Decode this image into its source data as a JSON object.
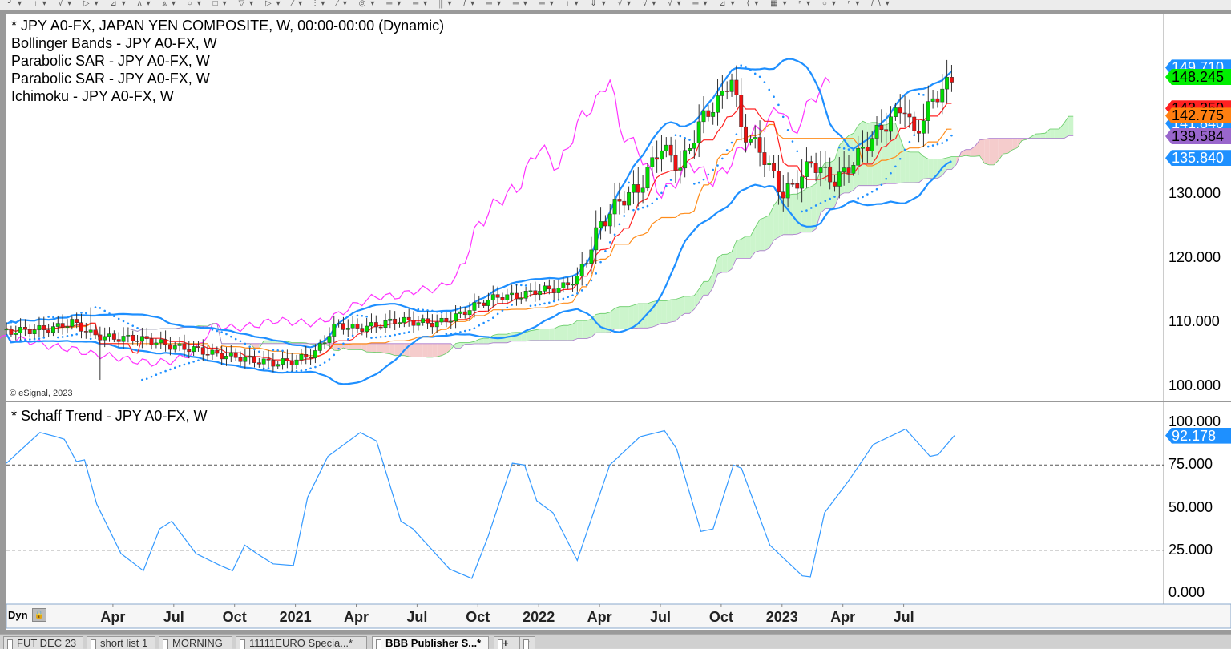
{
  "toolbar": {
    "icons": "╯▾ ↑▾ √▾ ▷▾ ⊿▾ ʌ▾ ⩓▾ ○▾ □▾ ▽▾ ▷▾ ⁄▾ ⫶▾ ⁄▾ ◎▾ ═▾ ═▾ ⫼▾ /▾ ═▾ ═▾ ═▾ ↑▾ ⇓▾ √▾ √▾ √▾ ═▾ ⊿▾ ⟨▾ ▦▾ ⁿ▾ ○▾ ⁿ▾ /\\▾"
  },
  "legend": [
    "* JPY A0-FX, JAPAN YEN COMPOSITE, W, 00:00-00:00 (Dynamic)",
    "Bollinger Bands - JPY A0-FX, W",
    "Parabolic SAR - JPY A0-FX, W",
    "Parabolic SAR - JPY A0-FX, W",
    "Ichimoku - JPY A0-FX, W"
  ],
  "copyright": "© eSignal, 2023",
  "lower_legend": "* Schaff Trend - JPY A0-FX, W",
  "badges": [
    {
      "value": "149.710",
      "color": "#1e90ff",
      "text": "#fff",
      "price": 149.71
    },
    {
      "value": "148.245",
      "color": "#00ee00",
      "text": "#000",
      "price": 148.245
    },
    {
      "value": "143.350",
      "color": "#ff2020",
      "text": "#000",
      "price": 143.35
    },
    {
      "value": "141.840",
      "color": "#1e90ff",
      "text": "#fff",
      "price": 141.0
    },
    {
      "value": "142.775",
      "color": "#ff7f11",
      "text": "#000",
      "price": 142.2
    },
    {
      "value": "139.584",
      "color": "#9966cc",
      "text": "#000",
      "price": 139.0
    },
    {
      "value": "135.840",
      "color": "#1e90ff",
      "text": "#fff",
      "price": 135.6
    }
  ],
  "schaff_badge": {
    "value": "92.178",
    "color": "#1e90ff",
    "text": "#fff"
  },
  "price_axis": [
    "100.000",
    "110.000",
    "120.000",
    "130.000"
  ],
  "schaff_axis": [
    "0.000",
    "25.000",
    "50.000",
    "75.000",
    "100.000"
  ],
  "x_labels": [
    {
      "m": 3,
      "label": "Apr"
    },
    {
      "m": 6,
      "label": "Jul"
    },
    {
      "m": 9,
      "label": "Oct"
    },
    {
      "m": 12,
      "label": "2021"
    },
    {
      "m": 15,
      "label": "Apr"
    },
    {
      "m": 18,
      "label": "Jul"
    },
    {
      "m": 21,
      "label": "Oct"
    },
    {
      "m": 24,
      "label": "2022"
    },
    {
      "m": 27,
      "label": "Apr"
    },
    {
      "m": 30,
      "label": "Jul"
    },
    {
      "m": 33,
      "label": "Oct"
    },
    {
      "m": 36,
      "label": "2023"
    },
    {
      "m": 39,
      "label": "Apr"
    },
    {
      "m": 42,
      "label": "Jul"
    }
  ],
  "dyn": "Dyn",
  "tabs": [
    "FUT DEC 23",
    "short list 1",
    "MORNING",
    "11111EURO Specia...*",
    "BBB  Publisher S...*"
  ],
  "tab_add": "+",
  "colors": {
    "up": "#00dd00",
    "down": "#ee1111",
    "bb": "#1e8fff",
    "tenkan": "#ff2020",
    "kijun": "#ff8c1a",
    "chikou": "#ff33ff",
    "sar": "#1e8fff",
    "cloud_up": "#ccf5cc",
    "cloud_down": "#f5cccc",
    "schaff": "#3399ff"
  },
  "chart_data": {
    "type": "candlestick",
    "title": "JPY A0-FX, JAPAN YEN COMPOSITE, W",
    "x_unit": "months since Jan 2020",
    "ylim": [
      98,
      156
    ],
    "price_close": [
      [
        -2.25,
        108.5
      ],
      [
        0,
        109
      ],
      [
        1,
        110
      ],
      [
        2,
        108
      ],
      [
        3,
        107.5
      ],
      [
        4,
        107.5
      ],
      [
        5,
        107
      ],
      [
        6,
        106.2
      ],
      [
        7,
        105.8
      ],
      [
        8,
        105
      ],
      [
        9,
        104.6
      ],
      [
        10,
        104
      ],
      [
        11,
        103.6
      ],
      [
        12,
        104
      ],
      [
        13,
        105.3
      ],
      [
        14,
        109.6
      ],
      [
        15,
        109
      ],
      [
        16,
        109.5
      ],
      [
        17,
        110.3
      ],
      [
        18,
        110
      ],
      [
        19,
        109.8
      ],
      [
        20,
        111
      ],
      [
        21,
        112.8
      ],
      [
        22,
        114
      ],
      [
        23,
        114
      ],
      [
        24,
        115
      ],
      [
        25,
        115.2
      ],
      [
        26,
        117
      ],
      [
        26.6,
        122
      ],
      [
        27,
        125
      ],
      [
        28,
        129
      ],
      [
        29,
        131
      ],
      [
        30,
        137.5
      ],
      [
        31,
        134
      ],
      [
        32,
        141.5
      ],
      [
        33,
        145
      ],
      [
        33.5,
        148.5
      ],
      [
        34,
        140
      ],
      [
        35,
        136.5
      ],
      [
        36,
        130
      ],
      [
        36.5,
        131
      ],
      [
        37.5,
        135
      ],
      [
        38.5,
        132
      ],
      [
        39,
        133
      ],
      [
        40.5,
        139
      ],
      [
        41.5,
        142
      ],
      [
        42,
        144
      ],
      [
        42.5,
        139
      ],
      [
        43.5,
        145
      ],
      [
        44.5,
        148.2
      ]
    ],
    "schaff_ylim": [
      0,
      100
    ],
    "schaff": [
      [
        -2.25,
        76
      ],
      [
        -0.6,
        94
      ],
      [
        0.2,
        91.5
      ],
      [
        0.6,
        90
      ],
      [
        1.2,
        77
      ],
      [
        1.6,
        78
      ],
      [
        2.2,
        52
      ],
      [
        3.4,
        23
      ],
      [
        4.5,
        13
      ],
      [
        5.3,
        37.5
      ],
      [
        5.9,
        42
      ],
      [
        7.1,
        23
      ],
      [
        8.3,
        16
      ],
      [
        8.9,
        13
      ],
      [
        9.5,
        28
      ],
      [
        10.1,
        23
      ],
      [
        10.9,
        17
      ],
      [
        11.9,
        16
      ],
      [
        12.6,
        56
      ],
      [
        13.6,
        80
      ],
      [
        15.2,
        94
      ],
      [
        16,
        89
      ],
      [
        17.2,
        42
      ],
      [
        17.8,
        37.5
      ],
      [
        19.6,
        14
      ],
      [
        20.7,
        8.5
      ],
      [
        21.5,
        33
      ],
      [
        22.7,
        76
      ],
      [
        23.3,
        75
      ],
      [
        23.9,
        54
      ],
      [
        24.7,
        47
      ],
      [
        25.9,
        19
      ],
      [
        27.5,
        75
      ],
      [
        29,
        91.5
      ],
      [
        30.2,
        95
      ],
      [
        30.8,
        84.5
      ],
      [
        32,
        36
      ],
      [
        32.6,
        37.5
      ],
      [
        33.6,
        75
      ],
      [
        34,
        73
      ],
      [
        35.4,
        28
      ],
      [
        37,
        10
      ],
      [
        37.4,
        9.4
      ],
      [
        38.1,
        47
      ],
      [
        39.3,
        66
      ],
      [
        40.5,
        87
      ],
      [
        42.1,
        96
      ],
      [
        43.3,
        80
      ],
      [
        43.7,
        81
      ],
      [
        44.5,
        92.2
      ]
    ],
    "schaff_levels": [
      25,
      75
    ]
  }
}
